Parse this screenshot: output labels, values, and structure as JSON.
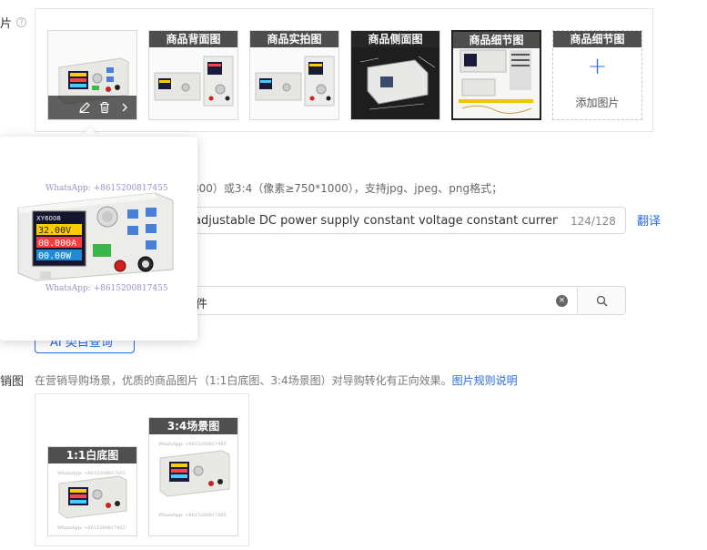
{
  "main_images": {
    "row_label": "片",
    "help_icon": "?",
    "thumbs": [
      {
        "title": "",
        "selected": true
      },
      {
        "title": "商品背面图"
      },
      {
        "title": "商品实拍图"
      },
      {
        "title": "商品侧面图"
      },
      {
        "title": "商品细节图"
      }
    ],
    "add_slot": {
      "title": "商品细节图",
      "plus": "+",
      "label": "添加图片"
    },
    "toolbar_icons": [
      "edit-icon",
      "delete-icon",
      "chevron-right-icon"
    ]
  },
  "image_hint": "800）或3:4（像素≥750*1000），支持jpg、jpeg、png格式；",
  "title_field": {
    "value": "adjustable DC power supply constant voltage constant current ma",
    "counter": "124/128",
    "translate_label": "翻译"
  },
  "category_field": {
    "value": "件",
    "search_icon": "search-icon"
  },
  "ai_button_label": "AI 类目查询",
  "marketing": {
    "row_label": "销图",
    "hint": "在营销导购场景，优质的商品图片（1:1白底图、3:4场景图）对导购转化有正向效果。",
    "rules_link": "图片规则说明",
    "square_title": "1:1白底图",
    "portrait_title": "3:4场景图"
  },
  "popover": {
    "watermark_top": "WhatsApp: +8615200817455",
    "watermark_bottom": "WhatsApp: +8615200817455",
    "device_brand": "XY6008",
    "readout": [
      "32.00V",
      "00.000A",
      "00.00W"
    ]
  },
  "colors": {
    "accent": "#2a6ae9",
    "thumb_title_bg": "#333333"
  }
}
